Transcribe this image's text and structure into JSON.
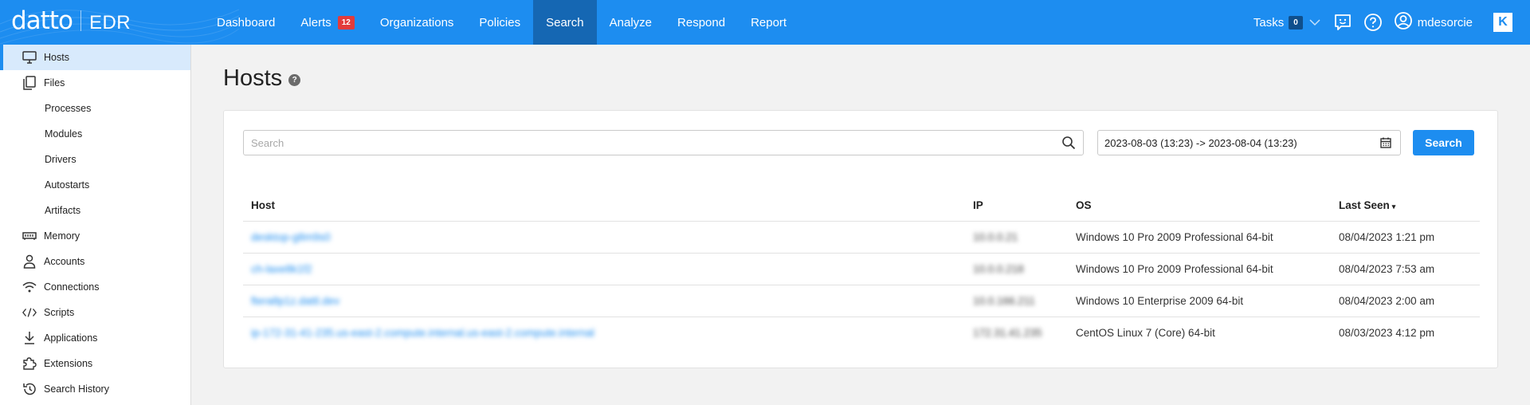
{
  "brand": {
    "logo": "datto",
    "product": "EDR"
  },
  "nav": {
    "items": [
      {
        "label": "Dashboard"
      },
      {
        "label": "Alerts",
        "badge": "12"
      },
      {
        "label": "Organizations"
      },
      {
        "label": "Policies"
      },
      {
        "label": "Search",
        "active": true
      },
      {
        "label": "Analyze"
      },
      {
        "label": "Respond"
      },
      {
        "label": "Report"
      }
    ]
  },
  "topright": {
    "tasks_label": "Tasks",
    "tasks_count": "0",
    "username": "mdesorcie",
    "k_logo": "K",
    "icons": [
      "chevron-down-icon",
      "feedback-icon",
      "help-icon",
      "user-icon",
      "kaseya-logo-icon"
    ]
  },
  "sidebar": {
    "items": [
      {
        "label": "Hosts",
        "icon": "monitor-icon",
        "active": true
      },
      {
        "label": "Files",
        "icon": "files-icon"
      },
      {
        "label": "Processes",
        "sub": true
      },
      {
        "label": "Modules",
        "sub": true
      },
      {
        "label": "Drivers",
        "sub": true
      },
      {
        "label": "Autostarts",
        "sub": true
      },
      {
        "label": "Artifacts",
        "sub": true
      },
      {
        "label": "Memory",
        "icon": "memory-icon"
      },
      {
        "label": "Accounts",
        "icon": "person-icon"
      },
      {
        "label": "Connections",
        "icon": "wifi-icon"
      },
      {
        "label": "Scripts",
        "icon": "code-icon"
      },
      {
        "label": "Applications",
        "icon": "download-icon"
      },
      {
        "label": "Extensions",
        "icon": "puzzle-icon"
      },
      {
        "label": "Search History",
        "icon": "history-icon"
      }
    ]
  },
  "page": {
    "title": "Hosts",
    "help": "?"
  },
  "search": {
    "placeholder": "Search",
    "value": ""
  },
  "date_range": {
    "value": "2023-08-03 (13:23) -> 2023-08-04 (13:23)"
  },
  "search_button": {
    "label": "Search"
  },
  "table": {
    "headers": {
      "host": "Host",
      "ip": "IP",
      "os": "OS",
      "last_seen": "Last Seen",
      "sort_indicator": "▾"
    },
    "rows": [
      {
        "host": "desktop-g8m9s0",
        "ip": "10.0.0.21",
        "os": "Windows 10 Pro 2009 Professional 64-bit",
        "last_seen": "08/04/2023 1:21 pm"
      },
      {
        "host": "ch-laxe8k1f2",
        "ip": "10.0.0.218",
        "os": "Windows 10 Pro 2009 Professional 64-bit",
        "last_seen": "08/04/2023 7:53 am"
      },
      {
        "host": "ftera8p1z.dattl.dev",
        "ip": "10.0.166.211",
        "os": "Windows 10 Enterprise 2009 64-bit",
        "last_seen": "08/04/2023 2:00 am"
      },
      {
        "host": "ip-172-31-41-235.us-east-2.compute.internal.us-east-2.compute.internal",
        "ip": "172.31.41.235",
        "os": "CentOS Linux 7 (Core) 64-bit",
        "last_seen": "08/03/2023 4:12 pm"
      }
    ]
  },
  "colors": {
    "primary": "#1d8df0",
    "nav_active": "#1567b3",
    "alert_badge": "#e23b3b",
    "sidebar_active": "#d8eafc"
  }
}
